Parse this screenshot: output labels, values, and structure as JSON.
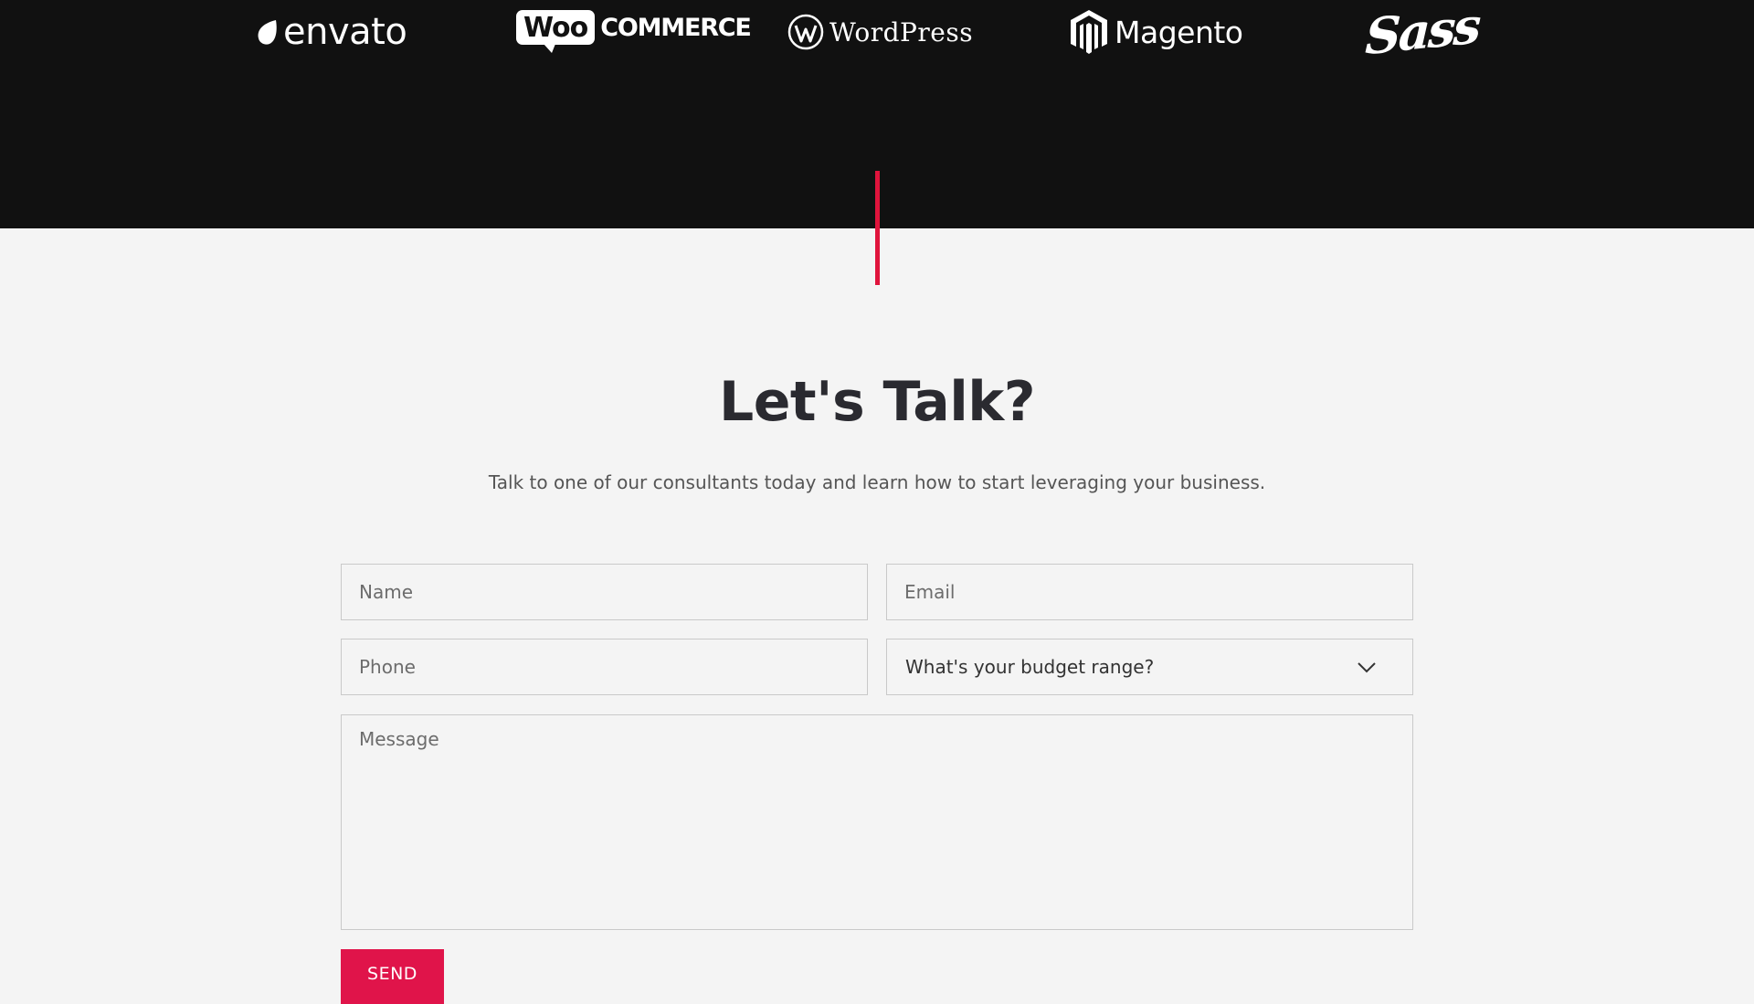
{
  "logos": {
    "envato": "envato",
    "woo": "Woo",
    "commerce": "COMMERCE",
    "wordpress": "WordPress",
    "magento": "Magento",
    "sass": "Sass"
  },
  "contact": {
    "title": "Let's Talk?",
    "subtitle": "Talk to one of our consultants today and learn how to start leveraging your business.",
    "name_placeholder": "Name",
    "email_placeholder": "Email",
    "phone_placeholder": "Phone",
    "budget_label": "What's your budget range?",
    "message_placeholder": "Message",
    "send_label": "SEND"
  },
  "colors": {
    "accent": "#e0144a",
    "dark_band": "#111111",
    "background": "#f4f4f4",
    "heading": "#2a2a30"
  },
  "icons": {
    "budget_dropdown": "chevron-down-icon",
    "envato_mark": "leaf-icon",
    "wordpress_mark": "wordpress-w-icon",
    "magento_mark": "magento-m-icon"
  }
}
